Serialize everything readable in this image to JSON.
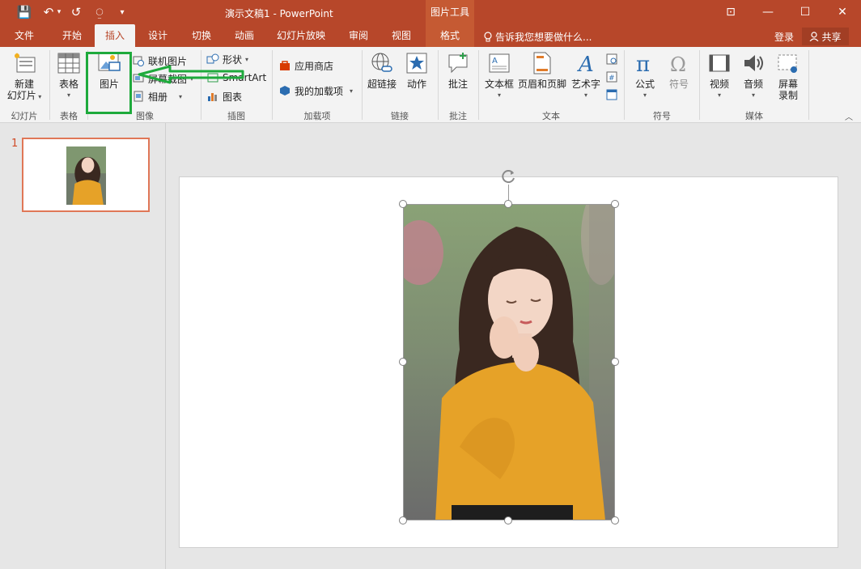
{
  "titlebar": {
    "doc_title": "演示文稿1 - PowerPoint",
    "context_tools": "图片工具",
    "qat": {
      "save": "💾",
      "undo": "↶",
      "undo_caret": "▾",
      "redo": "↺",
      "present": "⍜",
      "customize": "▾"
    },
    "window": {
      "restore_ribbon": "⊡",
      "minimize": "—",
      "maximize": "☐",
      "close": "✕"
    }
  },
  "tabs": [
    "文件",
    "开始",
    "插入",
    "设计",
    "切换",
    "动画",
    "幻灯片放映",
    "审阅",
    "视图",
    "格式"
  ],
  "active_tab": "插入",
  "tell_me": "告诉我您想要做什么...",
  "account": {
    "login": "登录",
    "share": "共享"
  },
  "ribbon": {
    "groups": {
      "slides": "幻灯片",
      "tables": "表格",
      "images": "图像",
      "illustrations": "插图",
      "addins": "加载项",
      "links": "链接",
      "comments": "批注",
      "text": "文本",
      "symbols": "符号",
      "media": "媒体"
    },
    "buttons": {
      "new_slide_1": "新建",
      "new_slide_2": "幻灯片",
      "table": "表格",
      "picture": "图片",
      "online_picture": "联机图片",
      "screenshot": "屏幕截图",
      "album": "相册",
      "shapes": "形状",
      "smartart": "SmartArt",
      "chart": "图表",
      "store": "应用商店",
      "my_addins": "我的加载项",
      "hyperlink": "超链接",
      "action": "动作",
      "comment": "批注",
      "textbox": "文本框",
      "header_footer": "页眉和页脚",
      "wordart": "艺术字",
      "equation": "公式",
      "symbol": "符号",
      "video": "视频",
      "audio": "音频",
      "screen_rec_1": "屏幕",
      "screen_rec_2": "录制"
    }
  },
  "thumbnails": {
    "slide_number": "1"
  },
  "colors": {
    "accent": "#b7472a",
    "annotation": "#1eaa3c",
    "thumb_border": "#e07757"
  }
}
